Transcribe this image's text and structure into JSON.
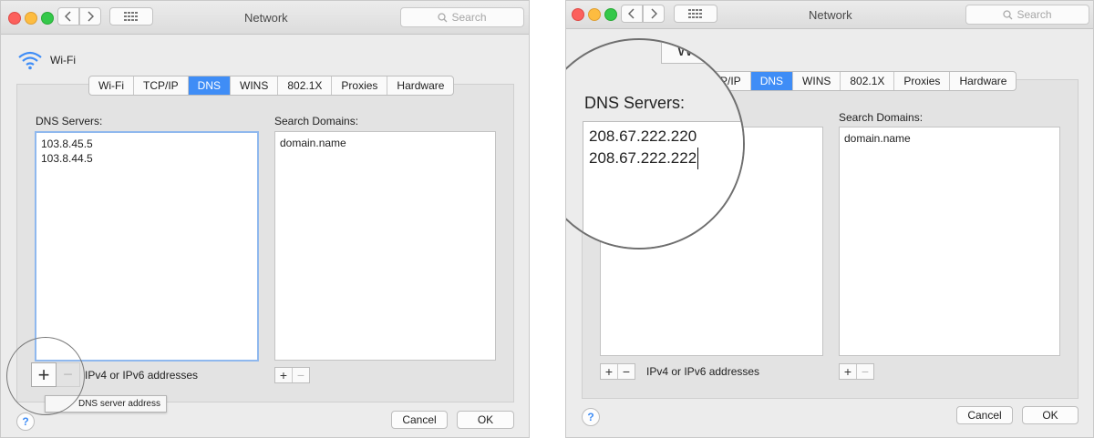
{
  "window": {
    "title": "Network",
    "search_placeholder": "Search"
  },
  "left": {
    "interface_name": "Wi-Fi",
    "tabs": [
      "Wi-Fi",
      "TCP/IP",
      "DNS",
      "WINS",
      "802.1X",
      "Proxies",
      "Hardware"
    ],
    "active_tab": "DNS",
    "dns_servers_label": "DNS Servers:",
    "dns_servers": [
      "103.8.45.5",
      "103.8.44.5"
    ],
    "search_domains_label": "Search Domains:",
    "search_domains": [
      "domain.name"
    ],
    "add_symbol": "+",
    "remove_symbol": "−",
    "address_hint": "IPv4 or IPv6 addresses",
    "tooltip": "DNS server address",
    "cancel_label": "Cancel",
    "ok_label": "OK",
    "help_label": "?"
  },
  "right": {
    "tab_fragment": "Wi",
    "tabs_visible": [
      "P/IP",
      "DNS",
      "WINS",
      "802.1X",
      "Proxies",
      "Hardware"
    ],
    "active_tab": "DNS",
    "dns_servers_label": "DNS Servers:",
    "dns_servers": [
      "208.67.222.220",
      "208.67.222.222"
    ],
    "search_domains_label": "Search Domains:",
    "search_domains": [
      "domain.name"
    ],
    "add_symbol": "+",
    "remove_symbol": "−",
    "address_hint": "IPv4 or IPv6 addresses",
    "cancel_label": "Cancel",
    "ok_label": "OK",
    "help_label": "?"
  },
  "colors": {
    "accent": "#3f8df6",
    "close": "#fc605c",
    "minimize": "#fdbc40",
    "zoom": "#34c84a"
  },
  "icons": {
    "back": "chevron-left-icon",
    "forward": "chevron-right-icon",
    "grid": "grid-icon",
    "search": "search-icon",
    "wifi": "wifi-icon",
    "magnifier": "magnifier-icon"
  }
}
